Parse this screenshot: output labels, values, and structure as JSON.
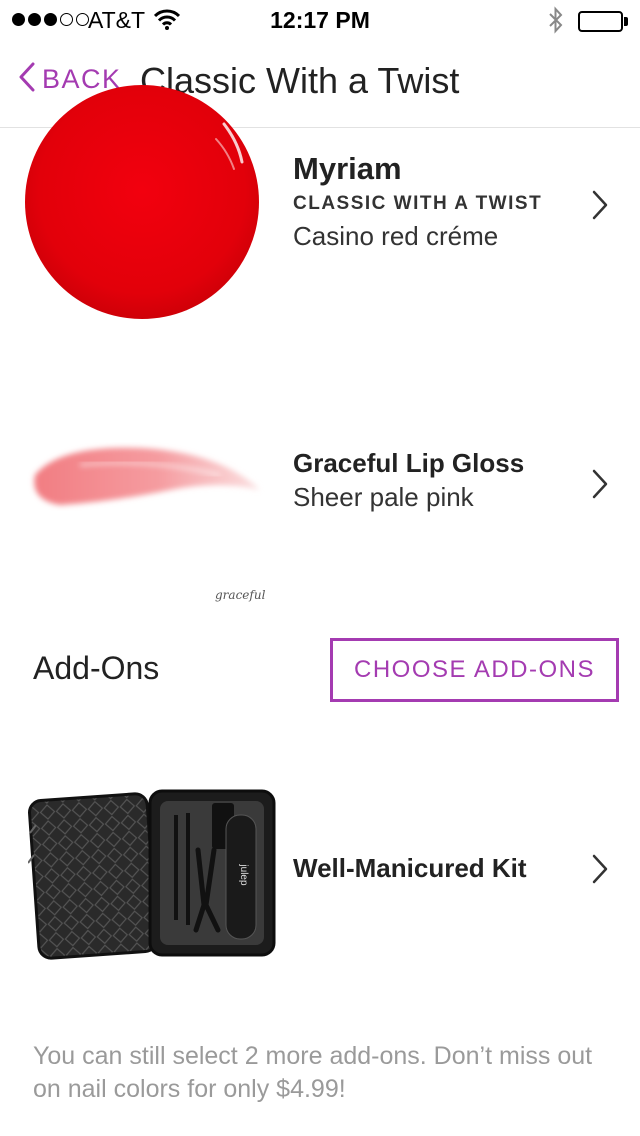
{
  "status_bar": {
    "carrier": "AT&T",
    "time": "12:17 PM",
    "signal_bars_filled": 3,
    "signal_bars_total": 5,
    "battery_level": 1.0
  },
  "nav": {
    "back_label": "BACK",
    "title": "Classic With a Twist"
  },
  "products": [
    {
      "name": "Myriam",
      "subtitle": "CLASSIC WITH A TWIST",
      "description": "Casino red créme",
      "swatch_color": "#e8000a"
    },
    {
      "name": "Graceful Lip Gloss",
      "description": "Sheer pale pink",
      "image_caption": "graceful",
      "swatch_color": "#f28a8e"
    }
  ],
  "addons": {
    "title": "Add-Ons",
    "button_label": "CHOOSE ADD-ONS",
    "items": [
      {
        "name": "Well-Manicured Kit",
        "case_brand": "julep"
      }
    ]
  },
  "footer": {
    "message": "You can still select 2 more add-ons. Don’t miss out on nail colors for only $4.99!"
  },
  "colors": {
    "accent": "#a43bb1",
    "text": "#222222",
    "muted": "#9a9a9a",
    "divider": "#e2e2e2"
  },
  "icons": [
    "wifi-icon",
    "bluetooth-icon",
    "battery-icon",
    "back-chevron-icon",
    "chevron-right-icon"
  ]
}
